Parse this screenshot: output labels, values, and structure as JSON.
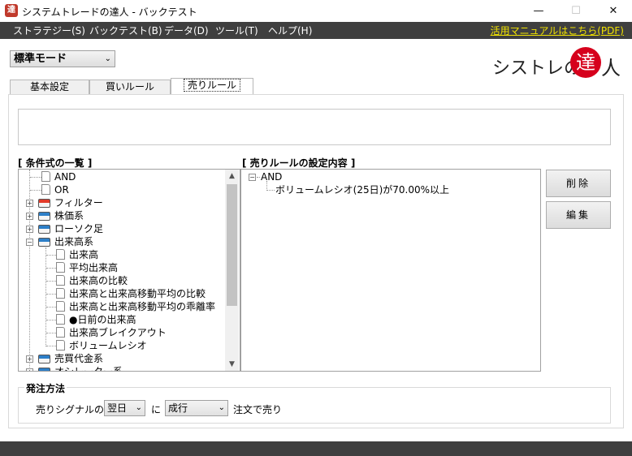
{
  "window": {
    "title": "システムトレードの達人 - バックテスト",
    "icon_char": "達",
    "minimize_glyph": "—",
    "maximize_glyph": "☐",
    "close_glyph": "✕"
  },
  "menubar": {
    "items": [
      "ストラテジー(S)",
      "バックテスト(B)",
      "データ(D)",
      "ツール(T)",
      "ヘルプ(H)"
    ],
    "manual_link": "活用マニュアルはこちら(PDF)"
  },
  "mode_select": {
    "value": "標準モード",
    "chevron": "⌄"
  },
  "logo": {
    "text_left": "シストレの",
    "circle_char": "達",
    "text_right": "人"
  },
  "tabs": [
    {
      "label": "基本設定"
    },
    {
      "label": "買いルール"
    },
    {
      "label": "売りルール"
    }
  ],
  "conditions": {
    "heading": "[ 条件式の一覧 ]",
    "items": {
      "and": "AND",
      "or": "OR",
      "filter": "フィルター",
      "price": "株価系",
      "candle": "ローソク足",
      "volume": "出来高系",
      "v1": "出来高",
      "v2": "平均出来高",
      "v3": "出来高の比較",
      "v4": "出来高と出来高移動平均の比較",
      "v5": "出来高と出来高移動平均の乖離率",
      "v6": "●日前の出来高",
      "v7": "出来高ブレイクアウト",
      "v8": "ボリュームレシオ",
      "trade_value": "売買代金系",
      "oscillator": "オシレーター系"
    },
    "expander_plus": "+",
    "expander_minus": "−"
  },
  "sell_rule": {
    "heading": "[ 売りルールの設定内容 ]",
    "root": "AND",
    "child": "ボリュームレシオ(25日)が70.00%以上"
  },
  "buttons": {
    "delete": "削除",
    "edit": "編集"
  },
  "order": {
    "legend": "発注方法",
    "prefix": "売りシグナルの",
    "day_value": "翌日",
    "ni": "に",
    "type_value": "成行",
    "suffix": "注文で売り"
  },
  "scroll": {
    "up": "▲",
    "down": "▼"
  }
}
